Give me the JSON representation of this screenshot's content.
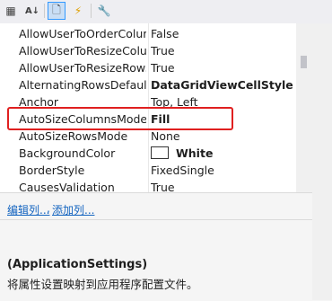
{
  "toolbar": {
    "buttons": [
      {
        "name": "categorized",
        "icon": "grid-list-icon"
      },
      {
        "name": "alphabetical",
        "icon": "sort-az-icon"
      },
      {
        "name": "properties",
        "icon": "property-page-icon",
        "active": true
      },
      {
        "name": "events",
        "icon": "lightning-icon"
      },
      {
        "name": "property-pages",
        "icon": "wrench-icon"
      }
    ]
  },
  "properties": [
    {
      "name": "AllowUserToOrderColumns",
      "value": "False"
    },
    {
      "name": "AllowUserToResizeColumns",
      "value": "True"
    },
    {
      "name": "AllowUserToResizeRows",
      "value": "True"
    },
    {
      "name": "AlternatingRowsDefaultCellStyle",
      "value": "DataGridViewCellStyle { BackColor"
    },
    {
      "name": "Anchor",
      "value": "Top, Left"
    },
    {
      "name": "AutoSizeColumnsMode",
      "value": "Fill"
    },
    {
      "name": "AutoSizeRowsMode",
      "value": "None"
    },
    {
      "name": "BackgroundColor",
      "value": "White"
    },
    {
      "name": "BorderStyle",
      "value": "FixedSingle"
    },
    {
      "name": "CausesValidation",
      "value": "True"
    }
  ],
  "commands": {
    "edit_columns": "编辑列...",
    "separator": ",",
    "add_column": "添加列..."
  },
  "description": {
    "title": "(ApplicationSettings)",
    "text": "将属性设置映射到应用程序配置文件。"
  },
  "colors": {
    "highlight": "#e02020",
    "link": "#1565c0",
    "toolbar_active": "#c9def5"
  }
}
